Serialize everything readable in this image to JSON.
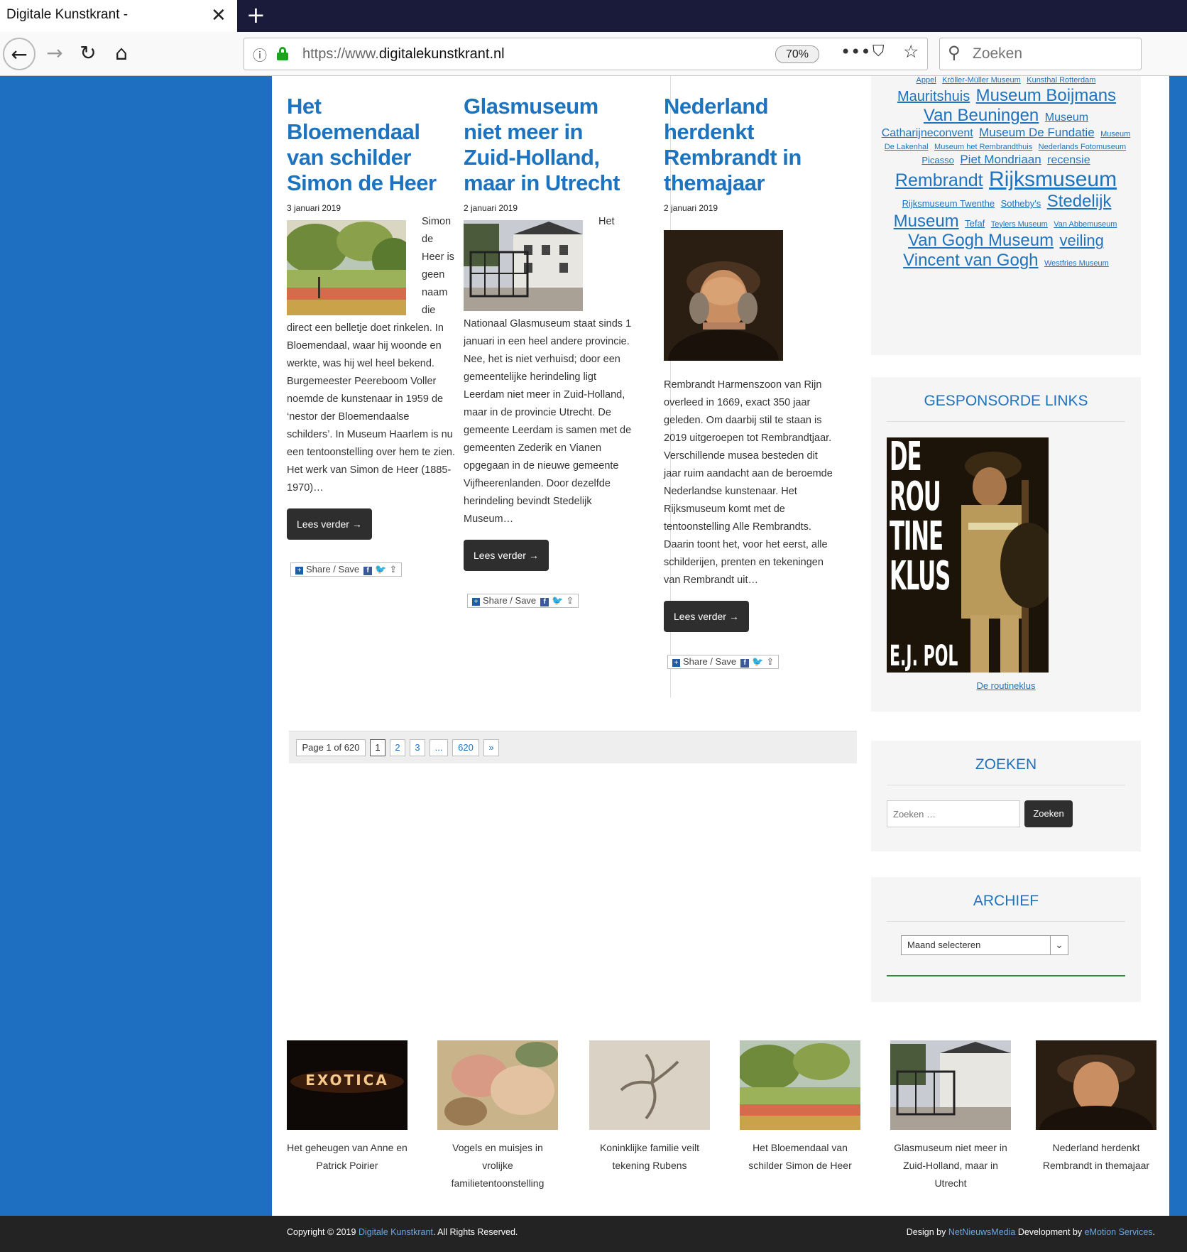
{
  "browser": {
    "tab_title": "Digitale Kunstkrant -",
    "url_prefix": "https://www.",
    "url_host": "digitalekunstkrant.nl",
    "zoom": "70%",
    "search_placeholder": "Zoeken"
  },
  "posts": [
    {
      "title": "Het Bloemendaal van schilder Simon de Heer",
      "date": "3 januari 2019",
      "excerpt_side": "Simon de Heer is geen naam die direct",
      "excerpt": "een belletje doet rinkelen. In Bloemendaal, waar hij woonde en werkte, was hij wel heel bekend. Burgemeester Peereboom Voller noemde de kunstenaar in 1959 de ‘nestor der Bloemendaalse schilders’. In Museum Haarlem is nu een tentoonstelling over hem te zien. Het werk van Simon de Heer (1885-1970)…",
      "read_more": "Lees verder →",
      "share": "Share / Save"
    },
    {
      "title": "Glasmuseum niet meer in Zuid-Holland, maar in Utrecht",
      "date": "2 januari 2019",
      "excerpt_side": "Het",
      "excerpt": "Nationaal Glasmuseum staat sinds 1 januari in een heel andere provincie. Nee, het is niet verhuisd; door een gemeentelijke herindeling ligt Leerdam niet meer in Zuid-Holland, maar in de provincie Utrecht. De gemeente Leerdam is samen met de gemeenten Zederik en Vianen opgegaan in de nieuwe gemeente Vijfheerenlanden. Door dezelfde herindeling bevindt Stedelijk Museum…",
      "read_more": "Lees verder →",
      "share": "Share / Save"
    },
    {
      "title": "Nederland herdenkt Rembrandt in themajaar",
      "date": "2 januari 2019",
      "excerpt": "Rembrandt Harmenszoon van Rijn overleed in 1669, exact 350 jaar geleden. Om daarbij stil te staan is 2019 uitgeroepen tot Rembrandtjaar. Verschillende musea besteden dit jaar ruim aandacht aan de beroemde Nederlandse kunstenaar. Het Rijksmuseum komt met de tentoonstelling Alle Rembrandts. Daarin toont het, voor het eerst, alle schilderijen, prenten en tekeningen van Rembrandt uit…",
      "read_more": "Lees verder →",
      "share": "Share / Save"
    }
  ],
  "pagination": {
    "label": "Page 1 of 620",
    "pages": [
      "1",
      "2",
      "3",
      "...",
      "620",
      "»"
    ]
  },
  "tagcloud": [
    {
      "text": "Appel",
      "size": 11
    },
    {
      "text": "Kröller-Müller Museum",
      "size": 11
    },
    {
      "text": "Kunsthal Rotterdam",
      "size": 11
    },
    {
      "text": "Mauritshuis",
      "size": 20
    },
    {
      "text": "Museum Boijmans Van Beuningen",
      "size": 24
    },
    {
      "text": "Museum Catharijneconvent",
      "size": 16
    },
    {
      "text": "Museum De Fundatie",
      "size": 17
    },
    {
      "text": "Museum De Lakenhal",
      "size": 11
    },
    {
      "text": "Museum het Rembrandthuis",
      "size": 11
    },
    {
      "text": "Nederlands Fotomuseum",
      "size": 11
    },
    {
      "text": "Picasso",
      "size": 13
    },
    {
      "text": "Piet Mondriaan",
      "size": 17
    },
    {
      "text": "recensie",
      "size": 16
    },
    {
      "text": "Rembrandt",
      "size": 25
    },
    {
      "text": "Rijksmuseum",
      "size": 30
    },
    {
      "text": "Rijksmuseum Twenthe",
      "size": 13
    },
    {
      "text": "Sotheby's",
      "size": 13
    },
    {
      "text": "Stedelijk Museum",
      "size": 24
    },
    {
      "text": "Tefaf",
      "size": 13
    },
    {
      "text": "Teylers Museum",
      "size": 11
    },
    {
      "text": "Van Abbemuseum",
      "size": 11
    },
    {
      "text": "Van Gogh Museum",
      "size": 24
    },
    {
      "text": "veiling",
      "size": 22
    },
    {
      "text": "Vincent van Gogh",
      "size": 24
    },
    {
      "text": "Westfries Museum",
      "size": 11
    }
  ],
  "sponsored": {
    "title": "GESPONSORDE LINKS",
    "book_title_lines": [
      "DE",
      "ROU",
      "TINE",
      "KLUS"
    ],
    "book_author": "E.J. POL",
    "link": "De routineklus"
  },
  "search_widget": {
    "title": "ZOEKEN",
    "placeholder": "Zoeken …",
    "button": "Zoeken"
  },
  "archive_widget": {
    "title": "ARCHIEF",
    "select": "Maand selecteren"
  },
  "related": [
    {
      "title": "Het geheugen van Anne en Patrick Poirier",
      "sign": "EXOTICA"
    },
    {
      "title": "Vogels en muisjes in vrolijke familietentoonstelling"
    },
    {
      "title": "Koninklijke familie veilt tekening Rubens"
    },
    {
      "title": "Het Bloemendaal van schilder Simon de Heer"
    },
    {
      "title": "Glasmuseum niet meer in Zuid-Holland, maar in Utrecht"
    },
    {
      "title": "Nederland herdenkt Rembrandt in themajaar"
    }
  ],
  "footer": {
    "copy_pre": "Copyright © 2019",
    "copy_link": "Digitale Kunstkrant",
    "copy_post": ". All Rights Reserved.",
    "design_pre": "Design by",
    "design_link1": "NetNieuwsMedia",
    "design_mid": "Development by",
    "design_link2": "eMotion Services",
    "design_post": "."
  },
  "colors": {
    "background": "#1e6fc2",
    "link": "#1e73be",
    "button": "#2e2e2e",
    "footer": "#232323"
  }
}
